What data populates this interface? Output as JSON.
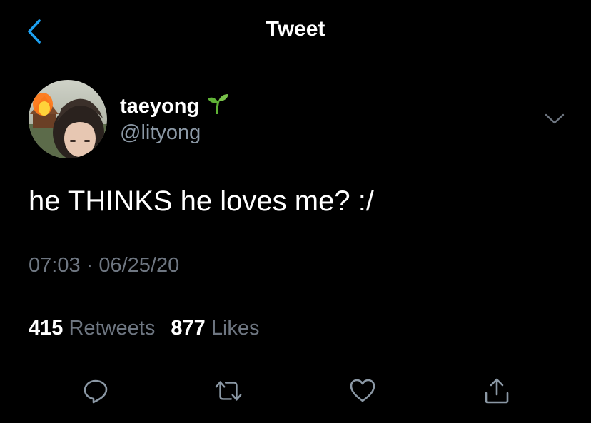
{
  "header": {
    "title": "Tweet",
    "back_icon": "chevron-left-icon"
  },
  "tweet": {
    "display_name": "taeyong",
    "name_emoji": "seedling-icon",
    "handle": "@lityong",
    "text": "he THINKS he loves me? :/",
    "timestamp": "07:03 · 06/25/20",
    "retweet_count": "415",
    "retweet_label": "Retweets",
    "like_count": "877",
    "like_label": "Likes"
  },
  "actions": [
    {
      "icon": "reply-icon"
    },
    {
      "icon": "retweet-icon"
    },
    {
      "icon": "like-icon"
    },
    {
      "icon": "share-icon"
    }
  ],
  "colors": {
    "background": "#000000",
    "accent": "#1da1f2",
    "muted_text": "#6e7681",
    "divider": "#2f3336",
    "icon": "#8b98a5",
    "sprout": "#5fb236"
  }
}
